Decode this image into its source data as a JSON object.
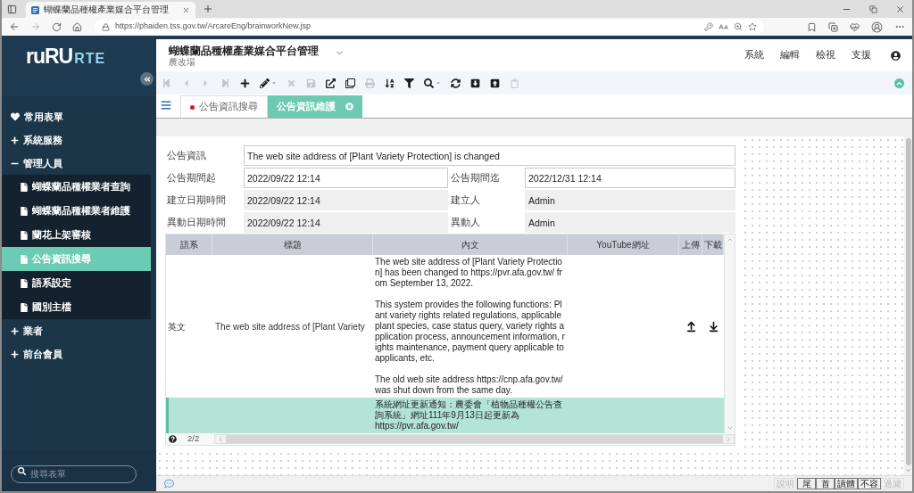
{
  "browser": {
    "tab_title": "蝴蝶蘭品種權產業媒合平台管理",
    "url": "https://phaiden.tss.gov.tw/ArcareEng/brainworkNew.jsp"
  },
  "sidebar": {
    "logo": {
      "primary": "ruRU",
      "secondary": "RTE"
    },
    "items": [
      {
        "kind": "favorite",
        "label": "常用表單"
      },
      {
        "kind": "group",
        "label": "系統服務",
        "expanded": false
      },
      {
        "kind": "group",
        "label": "管理人員",
        "expanded": true,
        "children": [
          {
            "label": "蝴蝶蘭品種權業者查詢",
            "selected": false
          },
          {
            "label": "蝴蝶蘭品種權業者維護",
            "selected": false
          },
          {
            "label": "蘭花上架審核",
            "selected": false
          },
          {
            "label": "公告資訊搜尋",
            "selected": true
          },
          {
            "label": "語系設定",
            "selected": false
          },
          {
            "label": "國別主檔",
            "selected": false
          }
        ]
      },
      {
        "kind": "group",
        "label": "業者",
        "expanded": false
      },
      {
        "kind": "group",
        "label": "前台會員",
        "expanded": false
      }
    ],
    "search": {
      "placeholder": "搜尋表單"
    }
  },
  "header": {
    "title": "蝴蝶蘭品種權產業媒合平台管理",
    "subtitle": "農改場",
    "menu": [
      "系統",
      "編輯",
      "檢視",
      "支援"
    ]
  },
  "toolbar": {
    "tools": [
      {
        "kind": "first",
        "disabled": true,
        "dropdown": false
      },
      {
        "kind": "previous",
        "disabled": true,
        "dropdown": false
      },
      {
        "kind": "next",
        "disabled": true,
        "dropdown": false
      },
      {
        "kind": "last",
        "disabled": true,
        "dropdown": false
      },
      {
        "kind": "add",
        "disabled": false,
        "dropdown": false
      },
      {
        "kind": "edit",
        "disabled": false,
        "dropdown": true
      },
      {
        "kind": "delete",
        "disabled": true,
        "dropdown": false
      },
      {
        "kind": "save",
        "disabled": true,
        "dropdown": false
      },
      {
        "kind": "open",
        "disabled": false,
        "dropdown": false
      },
      {
        "kind": "copy",
        "disabled": false,
        "dropdown": false
      },
      {
        "kind": "print",
        "disabled": true,
        "dropdown": false
      },
      {
        "kind": "sort",
        "disabled": false,
        "dropdown": false
      },
      {
        "kind": "filter",
        "disabled": false,
        "dropdown": false
      },
      {
        "kind": "search",
        "disabled": false,
        "dropdown": true
      },
      {
        "kind": "refresh",
        "disabled": false,
        "dropdown": false
      },
      {
        "kind": "import",
        "disabled": false,
        "dropdown": false
      },
      {
        "kind": "export",
        "disabled": false,
        "dropdown": false
      },
      {
        "kind": "clipboard",
        "disabled": true,
        "dropdown": false
      }
    ]
  },
  "tabs": [
    {
      "label": "公告資訊搜尋",
      "selected": false,
      "marked": true,
      "closable": false
    },
    {
      "label": "公告資訊維護",
      "selected": true,
      "marked": false,
      "closable": true
    }
  ],
  "form": {
    "rows": [
      [
        {
          "label": "公告資訊",
          "value": "The web site address of [Plant Variety Protection] is changed",
          "readonly": false
        }
      ],
      [
        {
          "label": "公告期間起",
          "value": "2022/09/22 12:14",
          "readonly": false
        },
        {
          "label": "公告期間迄",
          "value": "2022/12/31 12:14",
          "readonly": false
        }
      ],
      [
        {
          "label": "建立日期時間",
          "value": "2022/09/22 12:14",
          "readonly": true
        },
        {
          "label": "建立人",
          "value": "Admin",
          "readonly": true
        }
      ],
      [
        {
          "label": "異動日期時間",
          "value": "2022/09/22 12:14",
          "readonly": true
        },
        {
          "label": "異動人",
          "value": "Admin",
          "readonly": true
        }
      ]
    ]
  },
  "table": {
    "columns": [
      "語系",
      "標題",
      "內文",
      "YouTube網址",
      "上傳",
      "下載"
    ],
    "rows": [
      {
        "language": "英文",
        "title": "The web site address of [Plant Variety",
        "content": "The web site address of [Plant Variety Protection] has been changed to https://pvr.afa.gov.tw/ from September 13, 2022.\n\nThis system provides the following functions: Plant variety rights related regulations, applicable plant species, case status query, variety rights application process, announcement information, rights maintenance, payment query applicable to applicants, etc.\n\nThe old web site address https://cnp.afa.gov.tw/ was shut down from the same day.",
        "upload": true,
        "download": true,
        "selected": false
      },
      {
        "content": "系統網址更新通知：農委會「植物品種權公告查詢系統」網址111年9月13日起更新為\nhttps://pvr.afa.gov.tw/",
        "upload": false,
        "download": false,
        "selected": true
      }
    ],
    "pager": "2/2"
  },
  "status_bar": {
    "buttons": [
      {
        "label": "說明",
        "disabled": true
      },
      {
        "label": "尾",
        "disabled": false
      },
      {
        "label": "首",
        "disabled": false
      },
      {
        "label": "讀體",
        "disabled": false
      },
      {
        "label": "不容",
        "disabled": false
      },
      {
        "label": "過濾",
        "disabled": true
      }
    ]
  }
}
